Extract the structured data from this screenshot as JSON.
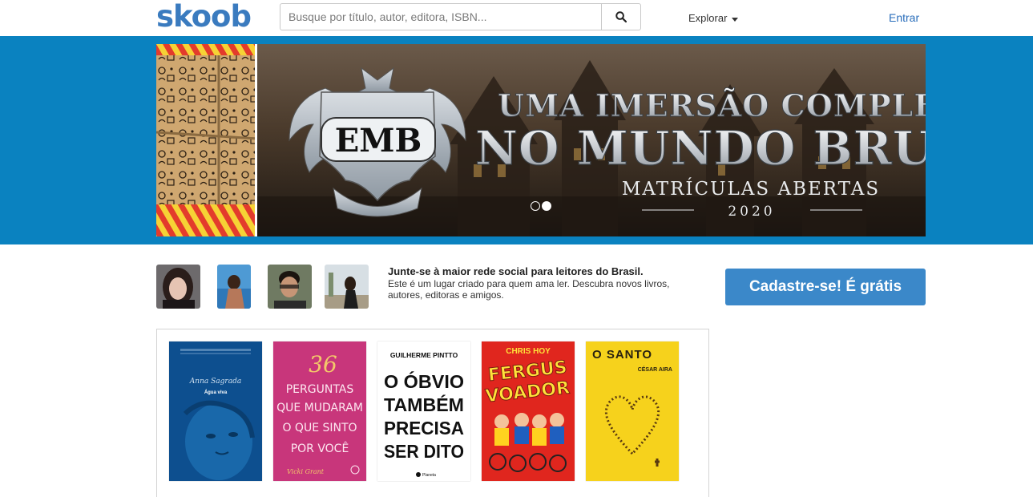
{
  "header": {
    "logo": "skoob",
    "search_placeholder": "Busque por título, autor, editora, ISBN...",
    "explore_label": "Explorar",
    "login_label": "Entrar"
  },
  "banner": {
    "emblem_text": "EMB",
    "line1": "UMA IMERSÃO COMPLET",
    "line2": "NO MUNDO BRUX",
    "line3": "MATRÍCULAS ABERTAS",
    "year": "2020",
    "slide_count": 2,
    "active_slide": 2
  },
  "join": {
    "title": "Junte-se à maior rede social para leitores do Brasil.",
    "description": "Este é um lugar criado para quem ama ler. Descubra novos livros, autores, editoras e amigos.",
    "cta_label": "Cadastre-se! É grátis"
  },
  "books": [
    {
      "author": "Anna Sagrada",
      "title": "Água viva"
    },
    {
      "number": "36",
      "title_lines": [
        "PERGUNTAS",
        "QUE MUDARAM",
        "O QUE SINTO",
        "POR VOCÊ"
      ],
      "author": "Vicki Grant"
    },
    {
      "author": "GUILHERME PINTTO",
      "title_lines": [
        "O ÓBVIO",
        "TAMBÉM",
        "PRECISA",
        "SER DITO"
      ],
      "publisher": "Planeta"
    },
    {
      "author": "CHRIS HOY",
      "title_lines": [
        "FERGUS",
        "VOADOR"
      ]
    },
    {
      "title": "O SANTO",
      "author": "CÉSAR AIRA"
    }
  ],
  "colors": {
    "brand_blue": "#3a7bbf",
    "band_blue": "#0a82c0",
    "cta_blue": "#3b88c9",
    "link_blue": "#2a6ebb"
  }
}
